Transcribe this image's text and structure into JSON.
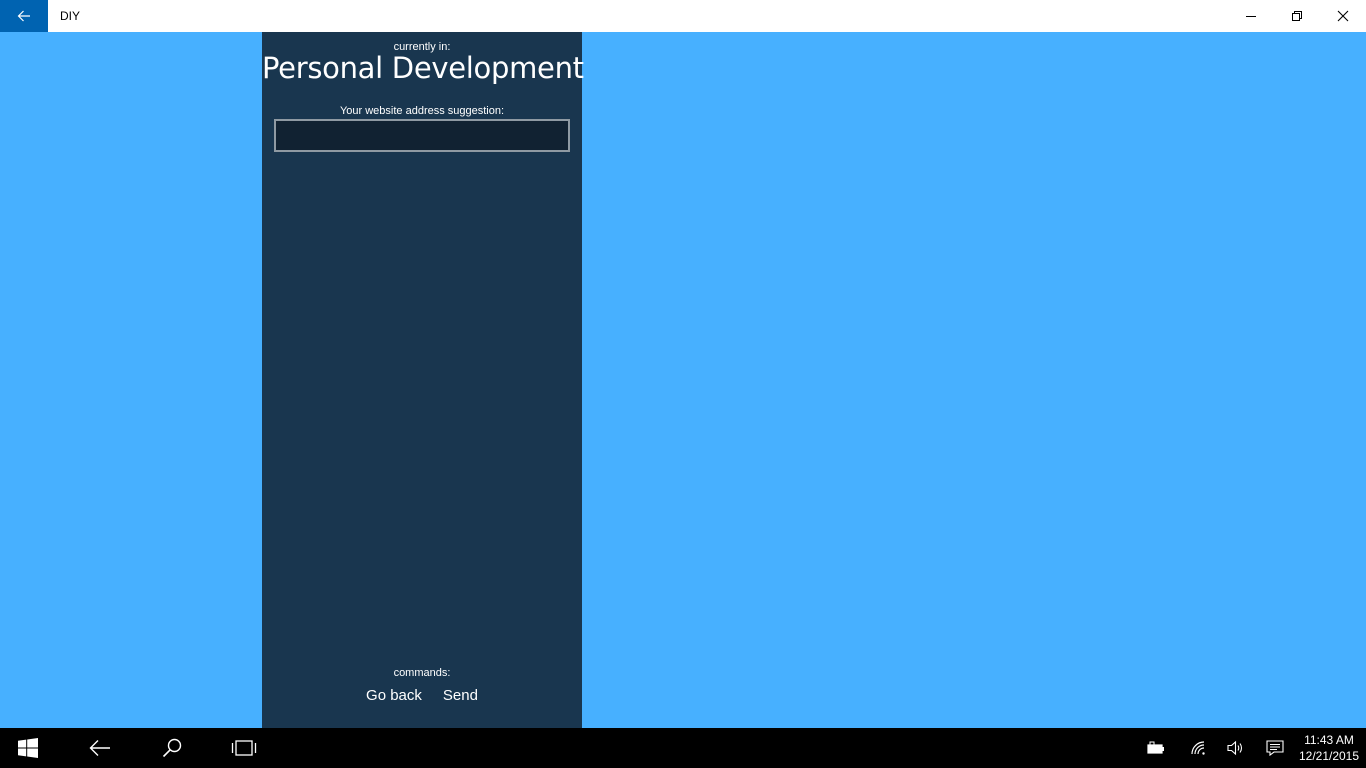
{
  "window": {
    "title": "DIY",
    "back_icon": "back-arrow-icon",
    "controls": [
      "minimize-icon",
      "restore-icon",
      "close-icon"
    ]
  },
  "panel": {
    "currently_label": "currently in:",
    "category": "Personal Development",
    "address_label": "Your website address suggestion:",
    "address_value": "",
    "address_placeholder": "",
    "commands_label": "commands:",
    "commands": [
      "Go back",
      "Send"
    ]
  },
  "taskbar": {
    "items": [
      "windows-start-icon",
      "back-arrow-icon",
      "search-icon",
      "task-view-icon"
    ],
    "tray": [
      "battery-icon",
      "wifi-icon",
      "volume-icon",
      "action-center-icon"
    ],
    "time": "11:43 AM",
    "date": "12/21/2015"
  },
  "colors": {
    "background": "#47b0ff",
    "panel": "#19364f",
    "input_bg": "#112232",
    "titlebar_back": "#0063b1",
    "taskbar": "#000000"
  }
}
